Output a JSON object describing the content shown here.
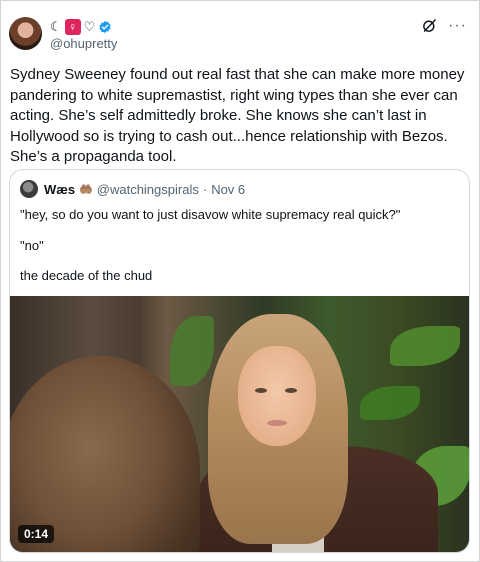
{
  "author": {
    "name_glyphs": [
      "☾",
      "♀",
      "♡"
    ],
    "verified": true,
    "handle": "@ohupretty"
  },
  "header_actions": {
    "grok_icon": "grok-icon",
    "more_label": "···"
  },
  "tweet": {
    "text": "Sydney Sweeney found out real fast that she can make more money pandering to white supremastist, right wing types than she ever can acting. She’s self admittedly broke. She knows she can’t last in Hollywood so is trying to cash out...hence relationship with Bezos. She’s a propaganda tool."
  },
  "quote": {
    "name": "Wæs",
    "emoji": "🤲🏽",
    "handle": "@watchingspirals",
    "separator": "·",
    "date": "Nov 6",
    "lines": [
      "\"hey, so do you want to just disavow white supremacy real quick?\"",
      "\"no\"",
      "the decade of the chud"
    ],
    "video_duration": "0:14"
  },
  "colors": {
    "verified": "#1d9bf0",
    "female_badge": "#e0245e",
    "secondary_text": "#536471",
    "border": "#cfd9de"
  }
}
